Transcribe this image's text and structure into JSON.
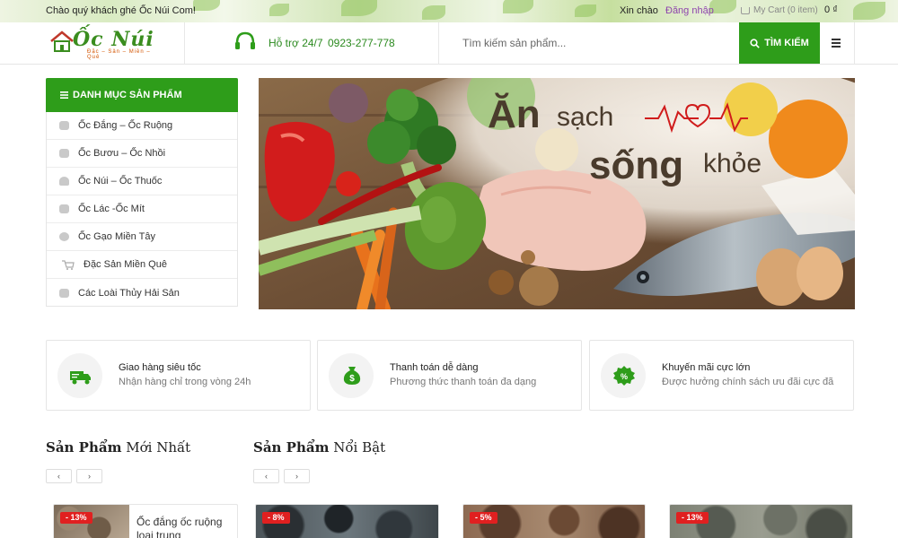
{
  "topbar": {
    "welcome": "Chào quý khách ghé Ốc Núi Com!",
    "hello": "Xin chào",
    "login": "Đăng nhập",
    "cart": "My Cart (0 item)",
    "price": "0 ₫"
  },
  "header": {
    "logo_text": "Ốc Núi",
    "logo_sub": "Đặc – Sản – Miền – Quê",
    "support_label": "Hỗ trợ 24/7",
    "support_phone": "0923-277-778",
    "search_placeholder": "Tìm kiếm sản phẩm...",
    "search_button": "TÌM KIẾM"
  },
  "categories": {
    "title": "DANH MỤC SẢN PHẨM",
    "items": [
      {
        "label": "Ốc Đắng – Ốc Ruộng"
      },
      {
        "label": "Ốc Bươu – Ốc Nhồi"
      },
      {
        "label": "Ốc Núi – Ốc Thuốc"
      },
      {
        "label": "Ốc Lác -Ốc Mít"
      },
      {
        "label": "Ốc Gạo Miền Tây"
      },
      {
        "label": "Đặc Sản Miền Quê"
      },
      {
        "label": "Các Loài Thủy Hải Sản"
      }
    ]
  },
  "banner": {
    "line1_big": "Ăn",
    "line1_small": "sạch",
    "line2_big": "sống",
    "line2_small": "khỏe"
  },
  "features": [
    {
      "title": "Giao hàng siêu tốc",
      "subtitle": "Nhận hàng chỉ trong vòng 24h",
      "icon": "truck-icon"
    },
    {
      "title": "Thanh toán dễ dàng",
      "subtitle": "Phương thức thanh toán đa dạng",
      "icon": "money-bag-icon"
    },
    {
      "title": "Khuyến mãi cực lớn",
      "subtitle": "Được hưởng chính sách ưu đãi cực đã",
      "icon": "discount-badge-icon"
    }
  ],
  "sections": {
    "new_bold": "Sản Phẩm",
    "new_rest": "Mới Nhất",
    "featured_bold": "Sản Phẩm",
    "featured_rest": "Nổi Bật",
    "prev": "‹",
    "next": "›"
  },
  "products": [
    {
      "badge": "- 13%",
      "name": "Ốc đắng ốc ruộng loại trung"
    },
    {
      "badge": "- 8%"
    },
    {
      "badge": "- 5%"
    },
    {
      "badge": "- 13%"
    }
  ],
  "colors": {
    "brand_green": "#2e9d1a",
    "sale_red": "#e02020",
    "login_purple": "#8e44ad"
  }
}
